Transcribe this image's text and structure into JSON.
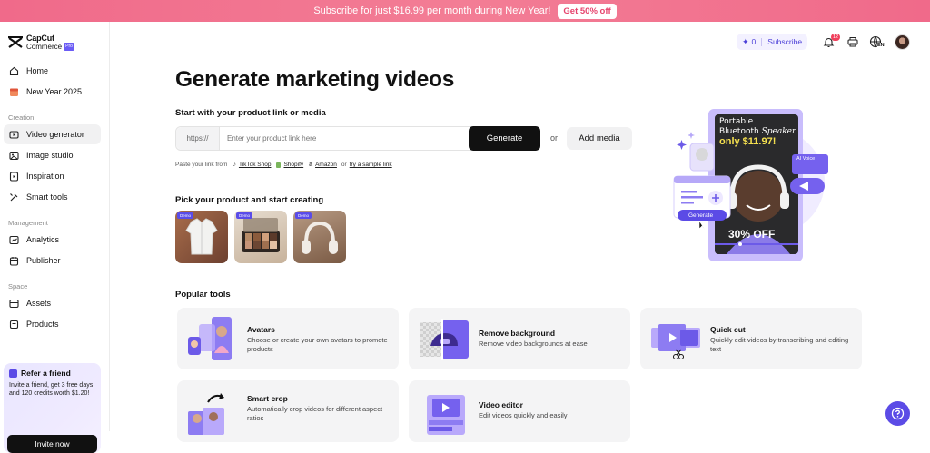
{
  "banner": {
    "text": "Subscribe for just $16.99 per month during New Year!",
    "button": "Get 50% off"
  },
  "logo": {
    "line1": "CapCut",
    "line2": "Commerce",
    "badge": "Pro"
  },
  "sidebar": {
    "items_top": [
      {
        "label": "Home",
        "icon": "home-icon"
      },
      {
        "label": "New Year 2025",
        "icon": "new-year-icon"
      }
    ],
    "sections": [
      {
        "title": "Creation"
      },
      {
        "title": "Management"
      },
      {
        "title": "Space"
      }
    ],
    "creation_items": [
      {
        "label": "Video generator",
        "icon": "video-icon",
        "active": true
      },
      {
        "label": "Image studio",
        "icon": "image-icon"
      },
      {
        "label": "Inspiration",
        "icon": "inspiration-icon"
      },
      {
        "label": "Smart tools",
        "icon": "tools-icon"
      }
    ],
    "management_items": [
      {
        "label": "Analytics",
        "icon": "analytics-icon"
      },
      {
        "label": "Publisher",
        "icon": "calendar-icon"
      }
    ],
    "space_items": [
      {
        "label": "Assets",
        "icon": "assets-icon"
      },
      {
        "label": "Products",
        "icon": "products-icon"
      }
    ],
    "refer": {
      "title": "Refer a friend",
      "desc": "Invite a friend, get 3 free days and 120 credits worth $1.20!",
      "button": "Invite now"
    }
  },
  "topbar": {
    "credits": "0",
    "subscribe": "Subscribe",
    "notifications": "12",
    "lang": "EN"
  },
  "main": {
    "title": "Generate marketing videos",
    "start_heading": "Start with your product link or media",
    "link_prefix": "https://",
    "link_placeholder": "Enter your product link here",
    "generate_button": "Generate",
    "or": "or",
    "add_media": "Add media",
    "paste_prefix": "Paste your link from",
    "sources": [
      "TikTok Shop",
      "Shopify",
      "Amazon"
    ],
    "paste_or": "or",
    "sample_link": "try a sample link",
    "pick_heading": "Pick your product and start creating",
    "demo_badge": "Demo",
    "popular_heading": "Popular tools",
    "tools": [
      {
        "title": "Avatars",
        "desc": "Choose or create your own avatars to promote products"
      },
      {
        "title": "Remove background",
        "desc": "Remove video backgrounds at ease"
      },
      {
        "title": "Quick cut",
        "desc": "Quickly edit videos by transcribing and editing text"
      },
      {
        "title": "Smart crop",
        "desc": "Automatically crop videos for different aspect ratios"
      },
      {
        "title": "Video editor",
        "desc": "Edit videos quickly and easily"
      }
    ]
  },
  "hero": {
    "line1": "Portable",
    "line2": "Bluetooth",
    "line2b": "Speaker",
    "line3": "only $11.97!",
    "discount": "30% OFF",
    "ai_voice": "AI Voice",
    "generate": "Generate"
  },
  "colors": {
    "accent": "#5b4be6",
    "banner": "#f06a8a",
    "hero_purple": "#c9bdfc"
  }
}
